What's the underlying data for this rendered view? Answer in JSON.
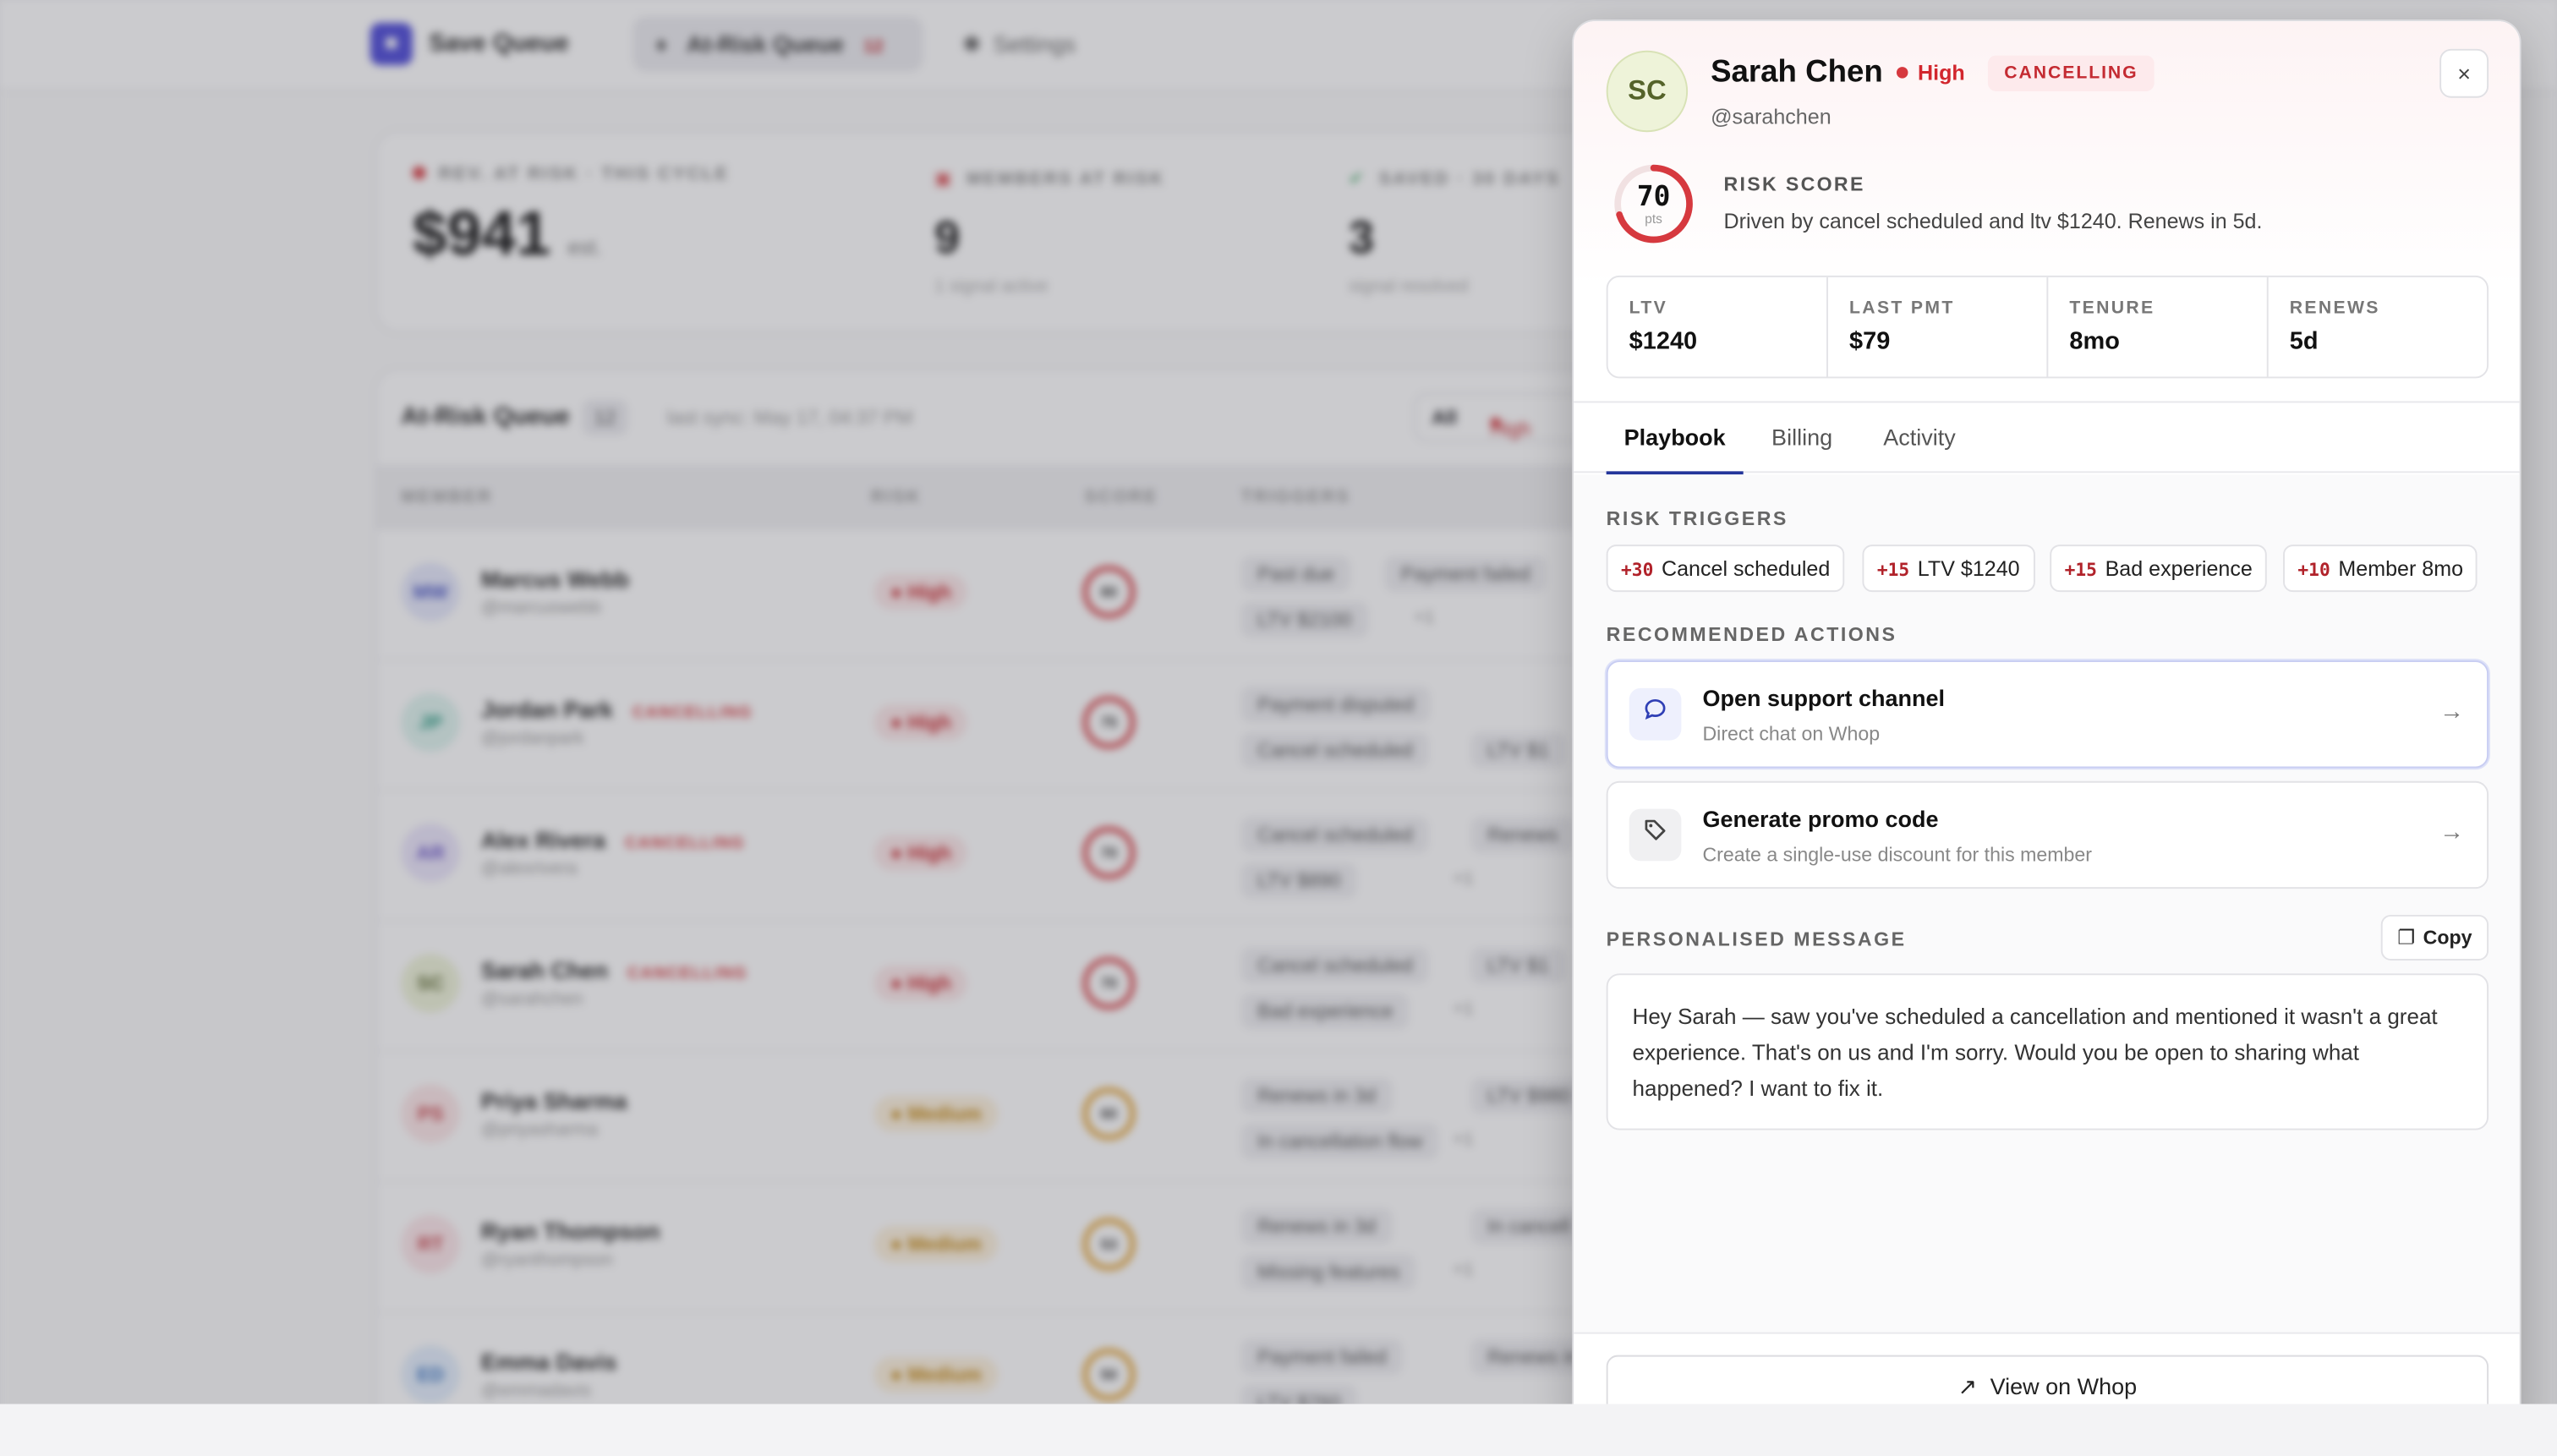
{
  "app": {
    "brand": "Save Queue",
    "nav": [
      {
        "label": "At-Risk Queue",
        "badge": "12"
      },
      {
        "label": "Settings"
      }
    ]
  },
  "stats": [
    {
      "label": "REV. AT RISK · THIS CYCLE",
      "value": "$941",
      "suffix": "est."
    },
    {
      "label": "MEMBERS AT RISK",
      "value": "9",
      "sub": "1 signal active"
    },
    {
      "label": "SAVED · 30 DAYS",
      "value": "3",
      "sub": "signal resolved"
    }
  ],
  "queue": {
    "title": "At-Risk Queue",
    "count": "12",
    "sync": "last sync: May 17, 04:37 PM",
    "filters": [
      "All",
      "High"
    ],
    "columns": [
      "MEMBER",
      "RISK",
      "SCORE",
      "TRIGGERS"
    ],
    "rows": [
      {
        "initials": "MW",
        "name": "Marcus Webb",
        "handle": "@marcuswebb",
        "cancelling": "",
        "risk": "High",
        "score": "80",
        "triggers": [
          "Past due",
          "Payment failed",
          "LTV $2100"
        ],
        "more": "+1"
      },
      {
        "initials": "JP",
        "name": "Jordan Park",
        "handle": "@jordanpark",
        "cancelling": "CANCELLING",
        "risk": "High",
        "score": "75",
        "triggers": [
          "Payment disputed",
          "Cancel scheduled",
          "LTV $1"
        ],
        "more": ""
      },
      {
        "initials": "AR",
        "name": "Alex Rivera",
        "handle": "@alexrivera",
        "cancelling": "CANCELLING",
        "risk": "High",
        "score": "70",
        "triggers": [
          "Cancel scheduled",
          "Renews",
          "LTV $890"
        ],
        "more": "+1"
      },
      {
        "initials": "SC",
        "name": "Sarah Chen",
        "handle": "@sarahchen",
        "cancelling": "CANCELLING",
        "risk": "High",
        "score": "70",
        "triggers": [
          "Cancel scheduled",
          "LTV $1",
          "Bad experience"
        ],
        "more": "+1"
      },
      {
        "initials": "PS",
        "name": "Priya Sharma",
        "handle": "@priyasharma",
        "cancelling": "",
        "risk": "Medium",
        "score": "60",
        "triggers": [
          "Renews in 3d",
          "LTV $980",
          "In cancellation flow"
        ],
        "more": "+1"
      },
      {
        "initials": "RT",
        "name": "Ryan Thompson",
        "handle": "@ryanthompson",
        "cancelling": "",
        "risk": "Medium",
        "score": "53",
        "triggers": [
          "Renews in 3d",
          "In cancell",
          "Missing features"
        ],
        "more": "+1"
      },
      {
        "initials": "ED",
        "name": "Emma Davis",
        "handle": "@emmadavis",
        "cancelling": "",
        "risk": "Medium",
        "score": "50",
        "triggers": [
          "Payment failed",
          "Renews in",
          "LTV $760"
        ],
        "more": ""
      }
    ]
  },
  "panel": {
    "initials": "SC",
    "name": "Sarah Chen",
    "risk": "High",
    "status": "CANCELLING",
    "handle": "@sarahchen",
    "close_label": "×",
    "risk_score": {
      "value": 70,
      "unit": "pts",
      "label": "RISK SCORE",
      "description": "Driven by cancel scheduled and ltv $1240. Renews in 5d."
    },
    "metrics": [
      {
        "label": "LTV",
        "value": "$1240"
      },
      {
        "label": "LAST PMT",
        "value": "$79"
      },
      {
        "label": "TENURE",
        "value": "8mo"
      },
      {
        "label": "RENEWS",
        "value": "5d"
      }
    ],
    "tabs": [
      "Playbook",
      "Billing",
      "Activity"
    ],
    "triggers_label": "RISK TRIGGERS",
    "triggers": [
      {
        "points": "+30",
        "label": "Cancel scheduled"
      },
      {
        "points": "+15",
        "label": "LTV $1240"
      },
      {
        "points": "+15",
        "label": "Bad experience"
      },
      {
        "points": "+10",
        "label": "Member 8mo"
      }
    ],
    "actions_label": "RECOMMENDED ACTIONS",
    "actions": [
      {
        "title": "Open support channel",
        "subtitle": "Direct chat on Whop",
        "icon": "chat-bubble-icon"
      },
      {
        "title": "Generate promo code",
        "subtitle": "Create a single-use discount for this member",
        "icon": "tag-icon"
      }
    ],
    "message_label": "PERSONALISED MESSAGE",
    "copy_label": "Copy",
    "message": "Hey Sarah — saw you've scheduled a cancellation and mentioned it wasn't a great experience. That's on us and I'm sorry. Would you be open to sharing what happened? I want to fix it.",
    "footer_button": "View on Whop"
  },
  "colors": {
    "accent": "#23359a",
    "danger": "#d6393f",
    "warning": "#e29d26",
    "brand": "#4c49d8"
  }
}
